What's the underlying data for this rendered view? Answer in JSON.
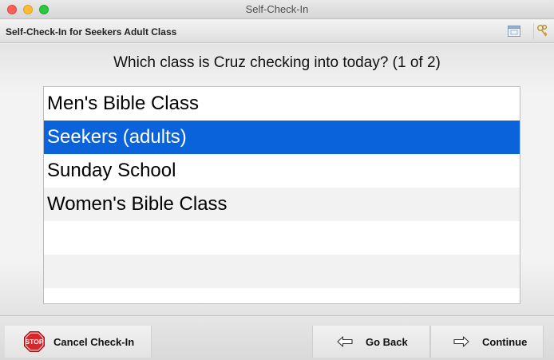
{
  "window": {
    "title": "Self-Check-In"
  },
  "header": {
    "title": "Self-Check-In for Seekers Adult Class",
    "icons": [
      "calendar-icon",
      "keys-icon"
    ]
  },
  "question": "Which class is Cruz checking into today? (1 of 2)",
  "classes": [
    {
      "label": "Men's Bible Class",
      "selected": false
    },
    {
      "label": "Seekers (adults)",
      "selected": true
    },
    {
      "label": "Sunday School",
      "selected": false
    },
    {
      "label": "Women's Bible Class",
      "selected": false
    }
  ],
  "toolbar": {
    "cancel_label": "Cancel Check-In",
    "back_label": "Go Back",
    "continue_label": "Continue",
    "stop_text": "STOP"
  },
  "colors": {
    "selection": "#0b63dc",
    "stop_sign": "#d8262a"
  }
}
